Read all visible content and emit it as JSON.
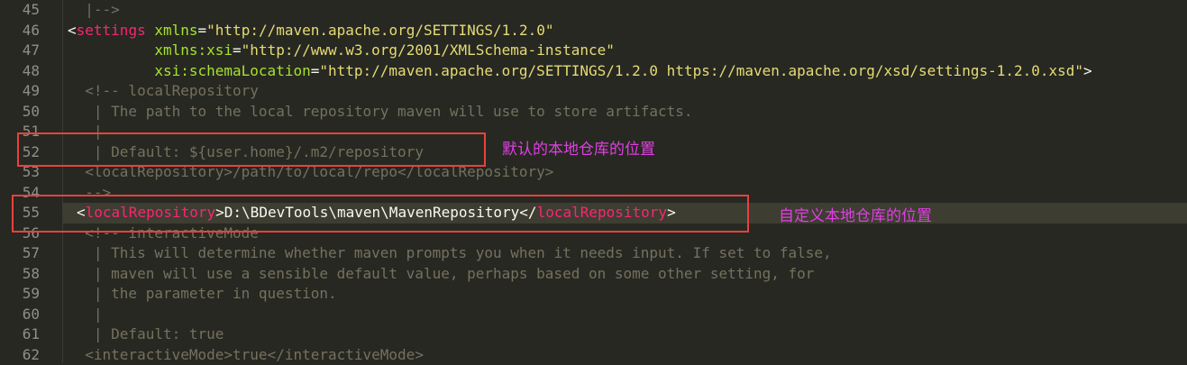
{
  "line_numbers": [
    "45",
    "46",
    "47",
    "48",
    "49",
    "50",
    "51",
    "52",
    "53",
    "54",
    "55",
    "56",
    "57",
    "58",
    "59",
    "60",
    "61",
    "62"
  ],
  "lines": {
    "l45": "  |-->",
    "l46_tag": "settings",
    "l46_attr": "xmlns",
    "l46_val": "\"http://maven.apache.org/SETTINGS/1.2.0\"",
    "l47_attr": "xmlns:xsi",
    "l47_val": "\"http://www.w3.org/2001/XMLSchema-instance\"",
    "l48_attr": "xsi:schemaLocation",
    "l48_val": "\"http://maven.apache.org/SETTINGS/1.2.0 https://maven.apache.org/xsd/settings-1.2.0.xsd\"",
    "l49": "  <!-- localRepository",
    "l50": "   | The path to the local repository maven will use to store artifacts.",
    "l51": "   |",
    "l52": "   | Default: ${user.home}/.m2/repository",
    "l53": "  <localRepository>/path/to/local/repo</localRepository>",
    "l54": "  -->",
    "l55_tag": "localRepository",
    "l55_text": "D:\\BDevTools\\maven\\MavenRepository",
    "l56": "  <!-- interactiveMode",
    "l57": "   | This will determine whether maven prompts you when it needs input. If set to false,",
    "l58": "   | maven will use a sensible default value, perhaps based on some other setting, for",
    "l59": "   | the parameter in question.",
    "l60": "   |",
    "l61": "   | Default: true",
    "l62": "  <interactiveMode>true</interactiveMode>"
  },
  "annotations": {
    "default_location": "默认的本地仓库的位置",
    "custom_location": "自定义本地仓库的位置"
  },
  "colors": {
    "background": "#272822",
    "annotation_box": "#e8413e",
    "annotation_text": "#e03fe3"
  }
}
